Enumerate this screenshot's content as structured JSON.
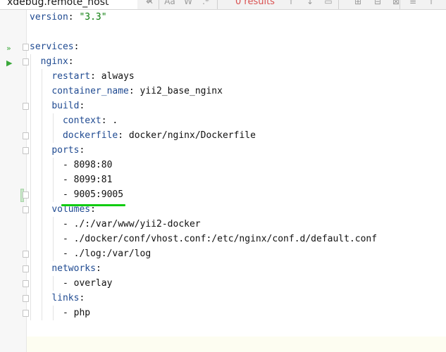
{
  "search": {
    "query": "xdebug.remote_host",
    "results": "0 results",
    "match_case_label": "Aa",
    "words_label": "W",
    "icons": [
      "close-icon",
      "enter-icon",
      "match-case-icon",
      "whole-word-icon",
      "regex-icon",
      "prev-occurrence-icon",
      "next-occurrence-icon",
      "select-all-icon",
      "filter-icon",
      "multiline-icon",
      "pin-icon"
    ]
  },
  "colors": {
    "key": "#1f4a91",
    "string": "#0b7d0b",
    "highlight_underline": "#11cc11",
    "results_error": "#d94f4f"
  },
  "editor": {
    "lines": [
      {
        "indent": "",
        "key": "version",
        "sep": ": ",
        "value": "\"3.3\"",
        "vtype": "string"
      },
      {
        "indent": "",
        "key": "",
        "sep": "",
        "value": "",
        "vtype": "plain"
      },
      {
        "indent": "",
        "key": "services",
        "sep": ":",
        "value": "",
        "vtype": "plain"
      },
      {
        "indent": "  ",
        "key": "nginx",
        "sep": ":",
        "value": "",
        "vtype": "plain"
      },
      {
        "indent": "    ",
        "key": "restart",
        "sep": ": ",
        "value": "always",
        "vtype": "plain"
      },
      {
        "indent": "    ",
        "key": "container_name",
        "sep": ": ",
        "value": "yii2_base_nginx",
        "vtype": "plain"
      },
      {
        "indent": "    ",
        "key": "build",
        "sep": ":",
        "value": "",
        "vtype": "plain"
      },
      {
        "indent": "      ",
        "key": "context",
        "sep": ": ",
        "value": ".",
        "vtype": "plain"
      },
      {
        "indent": "      ",
        "key": "dockerfile",
        "sep": ": ",
        "value": "docker/nginx/Dockerfile",
        "vtype": "plain"
      },
      {
        "indent": "    ",
        "key": "ports",
        "sep": ":",
        "value": "",
        "vtype": "plain"
      },
      {
        "indent": "      ",
        "key": "",
        "sep": "",
        "value": "- 8098:80",
        "vtype": "plain"
      },
      {
        "indent": "      ",
        "key": "",
        "sep": "",
        "value": "- 8099:81",
        "vtype": "plain"
      },
      {
        "indent": "      ",
        "key": "",
        "sep": "",
        "value": "- 9005:9005",
        "vtype": "plain"
      },
      {
        "indent": "    ",
        "key": "volumes",
        "sep": ":",
        "value": "",
        "vtype": "plain"
      },
      {
        "indent": "      ",
        "key": "",
        "sep": "",
        "value": "- ./:/var/www/yii2-docker",
        "vtype": "plain"
      },
      {
        "indent": "      ",
        "key": "",
        "sep": "",
        "value": "- ./docker/conf/vhost.conf:/etc/nginx/conf.d/default.conf",
        "vtype": "plain"
      },
      {
        "indent": "      ",
        "key": "",
        "sep": "",
        "value": "- ./log:/var/log",
        "vtype": "plain"
      },
      {
        "indent": "    ",
        "key": "networks",
        "sep": ":",
        "value": "",
        "vtype": "plain"
      },
      {
        "indent": "      ",
        "key": "",
        "sep": "",
        "value": "- overlay",
        "vtype": "plain"
      },
      {
        "indent": "    ",
        "key": "links",
        "sep": ":",
        "value": "",
        "vtype": "plain"
      },
      {
        "indent": "      ",
        "key": "",
        "sep": "",
        "value": "- php",
        "vtype": "plain"
      },
      {
        "indent": "",
        "key": "",
        "sep": "",
        "value": "",
        "vtype": "plain"
      }
    ],
    "gutter_markers": [
      {
        "line": 2,
        "icon": "run-all-icon",
        "glyph": "»",
        "fold": true
      },
      {
        "line": 3,
        "icon": "run-icon",
        "glyph": "▶",
        "fold": true
      },
      {
        "line": 6,
        "icon": "",
        "glyph": "",
        "fold": true
      },
      {
        "line": 8,
        "icon": "",
        "glyph": "",
        "fold": true
      },
      {
        "line": 9,
        "icon": "",
        "glyph": "",
        "fold": true
      },
      {
        "line": 12,
        "icon": "changed-line-icon",
        "glyph": "",
        "fold": true
      },
      {
        "line": 13,
        "icon": "",
        "glyph": "",
        "fold": true
      },
      {
        "line": 16,
        "icon": "",
        "glyph": "",
        "fold": true
      },
      {
        "line": 17,
        "icon": "",
        "glyph": "",
        "fold": true
      },
      {
        "line": 18,
        "icon": "",
        "glyph": "",
        "fold": true
      },
      {
        "line": 19,
        "icon": "",
        "glyph": "",
        "fold": true
      },
      {
        "line": 20,
        "icon": "",
        "glyph": "",
        "fold": true
      }
    ],
    "highlighted_line": 12
  }
}
